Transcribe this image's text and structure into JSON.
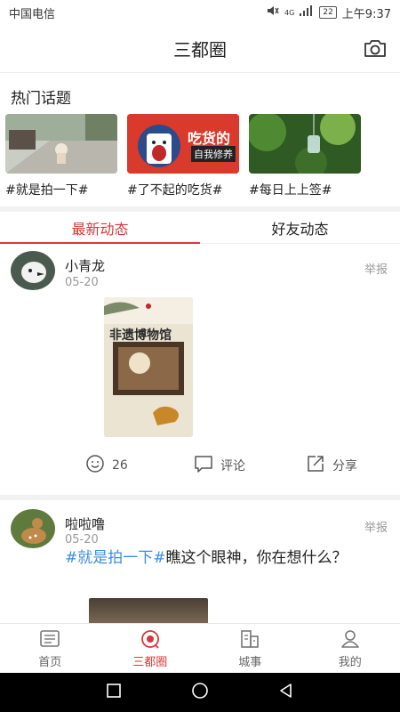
{
  "status": {
    "carrier": "中国电信",
    "signal": "4G",
    "battery": "22",
    "time": "上午9:37"
  },
  "header": {
    "title": "三都圈"
  },
  "hot_topics": {
    "title": "热门话题",
    "items": [
      {
        "label": "#就是拍一下#"
      },
      {
        "label": "#了不起的吃货#",
        "badge_line1": "吃货的",
        "badge_line2": "自我修养"
      },
      {
        "label": "#每日上上签#"
      }
    ]
  },
  "tabs": [
    {
      "label": "最新动态"
    },
    {
      "label": "好友动态"
    }
  ],
  "posts": [
    {
      "username": "小青龙",
      "date": "05-20",
      "report": "举报",
      "poster_text": "非遗博物馆",
      "likes": "26",
      "comment_label": "评论",
      "share_label": "分享"
    },
    {
      "username": "啦啦噜",
      "date": "05-20",
      "report": "举报",
      "hashtag": "#就是拍一下#",
      "text": "瞧这个眼神，你在想什么？"
    }
  ],
  "bottom_nav": [
    {
      "label": "首页"
    },
    {
      "label": "三都圈"
    },
    {
      "label": "城事"
    },
    {
      "label": "我的"
    }
  ],
  "colors": {
    "accent": "#d8383a",
    "hashtag": "#3a8ee6"
  }
}
